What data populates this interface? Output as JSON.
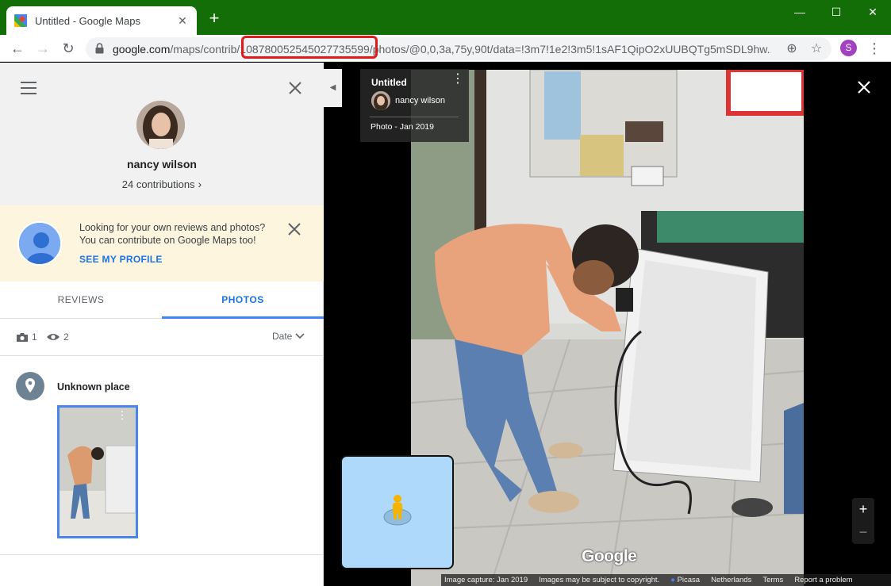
{
  "browser": {
    "tab_title": "Untitled - Google Maps",
    "tab_close": "✕",
    "new_tab": "+",
    "window_controls": {
      "minimize": "—",
      "maximize": "☐",
      "close": "✕"
    },
    "nav": {
      "back": "←",
      "forward": "→",
      "reload": "↻"
    },
    "url_host": "google.com",
    "url_path_prefix": "/maps/contrib/",
    "url_contributor_id": "108780052545027735599",
    "url_path_suffix": "/photos/@0,0,3a,75y,90t/data=!3m7!1e2!3m5!1sAF1QipO2xUUBQTg5mSDL9hw...",
    "profile_initial": "S"
  },
  "panel": {
    "user_name": "nancy wilson",
    "contributions": "24 contributions",
    "contributions_chevron": "›",
    "promo": {
      "line1": "Looking for your own reviews and photos?",
      "line2": "You can contribute on Google Maps too!",
      "link": "SEE MY PROFILE"
    },
    "tabs": [
      {
        "label": "REVIEWS",
        "active": false
      },
      {
        "label": "PHOTOS",
        "active": true
      }
    ],
    "stats": {
      "photos": "1",
      "views": "2",
      "sort_label": "Date"
    },
    "place": {
      "name": "Unknown place"
    }
  },
  "viewer": {
    "info_card": {
      "title": "Untitled",
      "author": "nancy wilson",
      "date": "Photo - Jan 2019"
    },
    "zoom": {
      "in": "+",
      "out": "−"
    },
    "google_logo": "Google",
    "footer": {
      "capture": "Image capture: Jan 2019",
      "copyright": "Images may be subject to copyright.",
      "source": "Picasa",
      "country": "Netherlands",
      "terms": "Terms",
      "report": "Report a problem"
    }
  },
  "colors": {
    "titlebar": "#136e07",
    "accent": "#1a73e8",
    "highlight": "#e01b1b",
    "promo_bg": "#fdf5de"
  }
}
